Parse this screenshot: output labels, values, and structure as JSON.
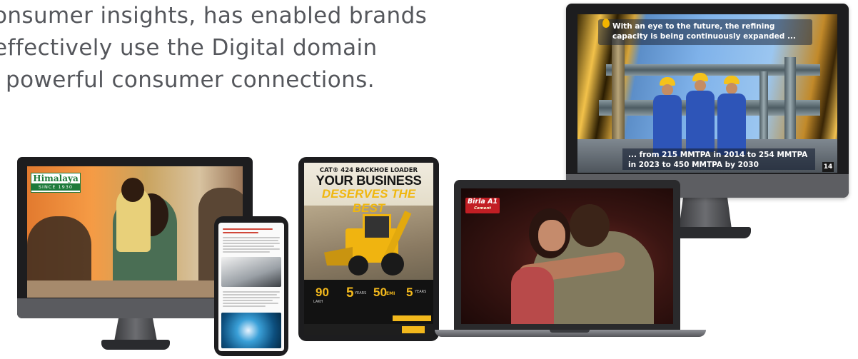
{
  "headline": {
    "lines": [
      "onsumer insights, has enabled brands",
      "effectively use the Digital domain",
      "powerful consumer connections."
    ],
    "color": "#55575c"
  },
  "right_monitor": {
    "caption_top": "With an eye to the future, the refining capacity is being continuously expanded ...",
    "caption_bottom": "... from 215 MMTPA in 2014 to 254 MMTPA in 2023 to 450 MMTPA by 2030",
    "page_number": "14",
    "accent": "#f3b400"
  },
  "left_monitor": {
    "logo_name": "Himalaya",
    "logo_since": "SINCE 1930",
    "brand_color": "#1d7a3a"
  },
  "tablet": {
    "ad_line1": "CAT® 424 BACKHOE LOADER",
    "ad_line2": "YOUR BUSINESS",
    "ad_line3": "DESERVES THE BEST",
    "stats": [
      "90",
      "5",
      "50",
      "5"
    ],
    "stat_units": [
      "LAKH",
      "YEARS",
      "EMI",
      "YEARS"
    ],
    "accent": "#f2b81c"
  },
  "laptop": {
    "logo_name": "Birla A1",
    "logo_sub": "Cement",
    "brand_color": "#c21e24"
  },
  "phone": {
    "icons": [
      "article-page",
      "car-image",
      "scuba-image"
    ]
  }
}
